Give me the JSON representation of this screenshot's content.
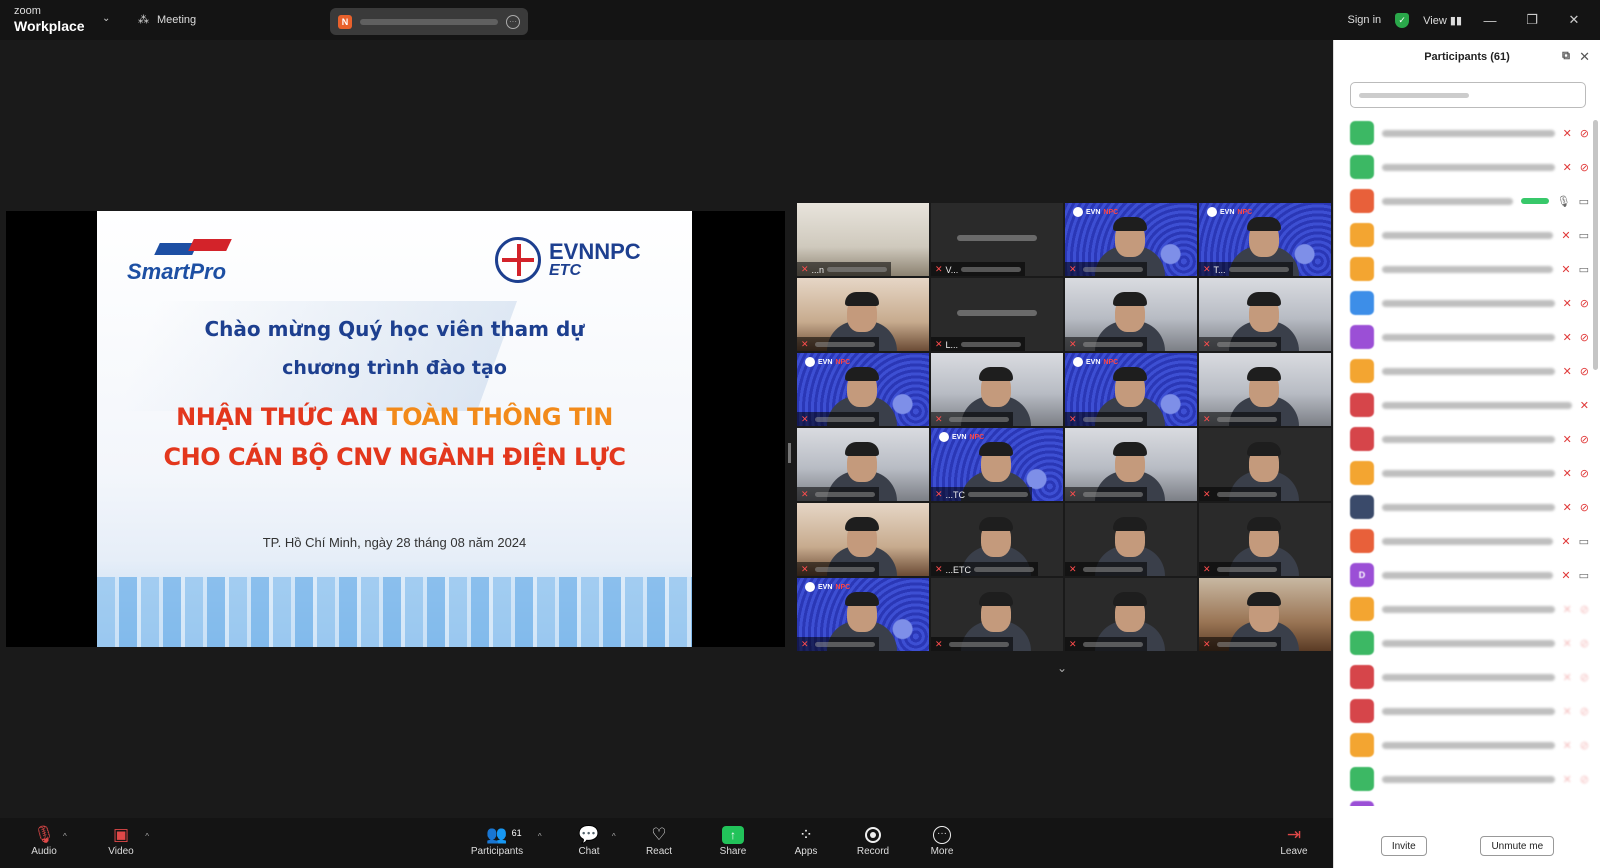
{
  "titlebar": {
    "brand_top": "zoom",
    "brand_bottom": "Workplace",
    "meeting_label": "Meeting",
    "share_initial": "N",
    "sign_in": "Sign in",
    "view": "View"
  },
  "slide": {
    "brand_left": "SmartPro",
    "brand_right_1": "EVNNPC",
    "brand_right_2": "ETC",
    "line1": "Chào mừng Quý học viên tham dự",
    "line2": "chương trình đào tạo",
    "line3a": "NHẬN THỨC AN ",
    "line3b": "TOÀN THÔNG TIN",
    "line4": "CHO CÁN BỘ CNV NGÀNH ĐIỆN LỰC",
    "line5": "TP. Hồ Chí Minh, ngày 28 tháng 08 năm 2024"
  },
  "gallery": {
    "tiles": [
      {
        "bg": "room",
        "name": "...n",
        "active": true
      },
      {
        "bg": "dark",
        "name": "V...",
        "active": false
      },
      {
        "bg": "evn",
        "name": "",
        "active": false
      },
      {
        "bg": "evn",
        "name": "T...",
        "active": false
      },
      {
        "bg": "warm",
        "name": "",
        "active": false
      },
      {
        "bg": "dark",
        "name": "L...",
        "active": false
      },
      {
        "bg": "office",
        "name": "",
        "active": false
      },
      {
        "bg": "office",
        "name": "",
        "active": false
      },
      {
        "bg": "evn",
        "name": "",
        "active": false
      },
      {
        "bg": "office",
        "name": "",
        "active": false
      },
      {
        "bg": "evn",
        "name": "",
        "active": false
      },
      {
        "bg": "office",
        "name": "",
        "active": false
      },
      {
        "bg": "office",
        "name": "",
        "active": false
      },
      {
        "bg": "evn",
        "name": "...TC",
        "active": false
      },
      {
        "bg": "office",
        "name": "",
        "active": false
      },
      {
        "bg": "dark",
        "name": "",
        "active": false
      },
      {
        "bg": "warm",
        "name": "",
        "active": false
      },
      {
        "bg": "dark",
        "name": "...ETC",
        "active": false
      },
      {
        "bg": "dark",
        "name": "",
        "active": false
      },
      {
        "bg": "dark",
        "name": "",
        "active": false
      },
      {
        "bg": "evn",
        "name": "",
        "active": false
      },
      {
        "bg": "dark",
        "name": "",
        "active": false
      },
      {
        "bg": "dark",
        "name": "",
        "active": false
      },
      {
        "bg": "sofa",
        "name": "",
        "active": false
      }
    ]
  },
  "participants_panel": {
    "title": "Participants (61)",
    "invite": "Invite",
    "unmute_me": "Unmute me",
    "rows": [
      {
        "color": "#3cb864",
        "initial": "",
        "state": "muted-off"
      },
      {
        "color": "#3cb864",
        "initial": "",
        "state": "muted-off"
      },
      {
        "color": "#e8603a",
        "initial": "",
        "state": "talking"
      },
      {
        "color": "#f3a531",
        "initial": "",
        "state": "muted-on"
      },
      {
        "color": "#f3a531",
        "initial": "",
        "state": "muted-on"
      },
      {
        "color": "#3d8ee8",
        "initial": "",
        "state": "muted-off"
      },
      {
        "color": "#9b4fd6",
        "initial": "",
        "state": "muted-off"
      },
      {
        "color": "#f3a531",
        "initial": "",
        "state": "muted-off"
      },
      {
        "color": "#d6454a",
        "initial": "",
        "state": "muted-only"
      },
      {
        "color": "#d6454a",
        "initial": "",
        "state": "muted-off"
      },
      {
        "color": "#f3a531",
        "initial": "",
        "state": "muted-off"
      },
      {
        "color": "#3a4a6a",
        "initial": "",
        "state": "muted-off"
      },
      {
        "color": "#e8603a",
        "initial": "",
        "state": "muted-on"
      },
      {
        "color": "#9b4fd6",
        "initial": "D",
        "state": "muted-on"
      },
      {
        "color": "#f3a531",
        "initial": "",
        "state": "faded"
      },
      {
        "color": "#3cb864",
        "initial": "",
        "state": "faded"
      },
      {
        "color": "#d6454a",
        "initial": "",
        "state": "faded"
      },
      {
        "color": "#d6454a",
        "initial": "",
        "state": "faded"
      },
      {
        "color": "#f3a531",
        "initial": "",
        "state": "faded"
      },
      {
        "color": "#3cb864",
        "initial": "",
        "state": "faded"
      },
      {
        "color": "#9b4fd6",
        "initial": "H",
        "state": "faded"
      }
    ]
  },
  "toolbar": {
    "audio": "Audio",
    "video": "Video",
    "participants": "Participants",
    "participants_count": "61",
    "chat": "Chat",
    "react": "React",
    "share": "Share",
    "apps": "Apps",
    "record": "Record",
    "more": "More",
    "leave": "Leave"
  }
}
